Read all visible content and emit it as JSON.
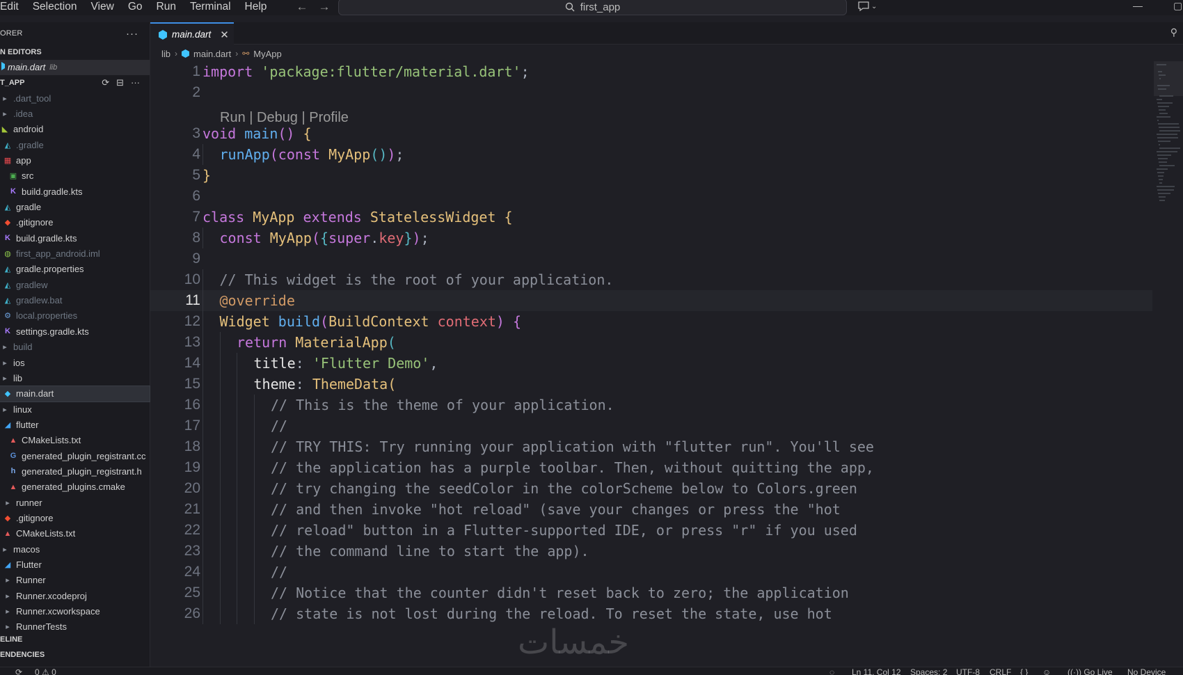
{
  "menu": [
    "Edit",
    "Selection",
    "View",
    "Go",
    "Run",
    "Terminal",
    "Help"
  ],
  "search": {
    "text": "first_app"
  },
  "sidebar": {
    "title": "ORER",
    "open_editors_title": "N EDITORS",
    "open_editor": {
      "name": "main.dart",
      "hint": "lib"
    },
    "project_title": "T_APP",
    "items": [
      {
        "label": ".dart_tool",
        "icon": "folder-icon",
        "dim": true,
        "indent": 0
      },
      {
        "label": ".idea",
        "icon": "folder-icon",
        "dim": true,
        "indent": 0
      },
      {
        "label": "android",
        "icon": "android-folder-icon",
        "dim": false,
        "indent": 0
      },
      {
        "label": ".gradle",
        "icon": "gradle-folder-icon",
        "dim": true,
        "indent": 1
      },
      {
        "label": "app",
        "icon": "app-folder-icon",
        "dim": false,
        "indent": 1
      },
      {
        "label": "src",
        "icon": "src-folder-icon",
        "dim": false,
        "indent": 2
      },
      {
        "label": "build.gradle.kts",
        "icon": "kotlin-icon",
        "dim": false,
        "indent": 2
      },
      {
        "label": "gradle",
        "icon": "gradle-folder-icon",
        "dim": false,
        "indent": 1
      },
      {
        "label": ".gitignore",
        "icon": "git-icon",
        "dim": false,
        "indent": 1
      },
      {
        "label": "build.gradle.kts",
        "icon": "kotlin-icon",
        "dim": false,
        "indent": 1
      },
      {
        "label": "first_app_android.iml",
        "icon": "iml-icon",
        "dim": true,
        "indent": 1
      },
      {
        "label": "gradle.properties",
        "icon": "gradle-icon",
        "dim": false,
        "indent": 1
      },
      {
        "label": "gradlew",
        "icon": "gradle-icon",
        "dim": true,
        "indent": 1
      },
      {
        "label": "gradlew.bat",
        "icon": "gradle-icon",
        "dim": true,
        "indent": 1
      },
      {
        "label": "local.properties",
        "icon": "gear-icon",
        "dim": true,
        "indent": 1
      },
      {
        "label": "settings.gradle.kts",
        "icon": "kotlin-icon",
        "dim": false,
        "indent": 1
      },
      {
        "label": "build",
        "icon": "folder-icon",
        "dim": true,
        "indent": 0
      },
      {
        "label": "ios",
        "icon": "folder-icon",
        "dim": false,
        "indent": 0
      },
      {
        "label": "lib",
        "icon": "folder-icon",
        "dim": false,
        "indent": 0
      },
      {
        "label": "main.dart",
        "icon": "dart-icon",
        "dim": false,
        "indent": 1,
        "selected": true
      },
      {
        "label": "linux",
        "icon": "folder-icon",
        "dim": false,
        "indent": 0
      },
      {
        "label": "flutter",
        "icon": "flutter-folder-icon",
        "dim": false,
        "indent": 1
      },
      {
        "label": "CMakeLists.txt",
        "icon": "cmake-icon",
        "dim": false,
        "indent": 2
      },
      {
        "label": "generated_plugin_registrant.cc",
        "icon": "cpp-icon",
        "dim": false,
        "indent": 2
      },
      {
        "label": "generated_plugin_registrant.h",
        "icon": "h-icon",
        "dim": false,
        "indent": 2
      },
      {
        "label": "generated_plugins.cmake",
        "icon": "cmake-icon",
        "dim": false,
        "indent": 2
      },
      {
        "label": "runner",
        "icon": "folder-icon",
        "dim": false,
        "indent": 1
      },
      {
        "label": ".gitignore",
        "icon": "git-icon",
        "dim": false,
        "indent": 1
      },
      {
        "label": "CMakeLists.txt",
        "icon": "cmake-icon",
        "dim": false,
        "indent": 1
      },
      {
        "label": "macos",
        "icon": "folder-icon",
        "dim": false,
        "indent": 0
      },
      {
        "label": "Flutter",
        "icon": "flutter-folder-icon",
        "dim": false,
        "indent": 1
      },
      {
        "label": "Runner",
        "icon": "folder-icon",
        "dim": false,
        "indent": 1
      },
      {
        "label": "Runner.xcodeproj",
        "icon": "folder-icon",
        "dim": false,
        "indent": 1
      },
      {
        "label": "Runner.xcworkspace",
        "icon": "folder-icon",
        "dim": false,
        "indent": 1
      },
      {
        "label": "RunnerTests",
        "icon": "folder-icon",
        "dim": false,
        "indent": 1
      }
    ],
    "timeline_title": "ELINE",
    "dependencies_title": "ENDENCIES"
  },
  "tab": {
    "label": "main.dart"
  },
  "breadcrumb": {
    "folder": "lib",
    "file": "main.dart",
    "symbol": "MyApp"
  },
  "codelens": "Run | Debug | Profile",
  "current_line": 11,
  "code_lines": [
    {
      "n": "1",
      "indent": 0,
      "tokens": [
        [
          "kw",
          "import"
        ],
        [
          "p",
          " "
        ],
        [
          "str",
          "'package:flutter/material.dart'"
        ],
        [
          "punc",
          ";"
        ]
      ]
    },
    {
      "n": "2",
      "indent": 0,
      "tokens": []
    },
    {
      "n": "3",
      "indent": 0,
      "tokens": [
        [
          "kw",
          "void"
        ],
        [
          "p",
          " "
        ],
        [
          "fn",
          "main"
        ],
        [
          "br2",
          "()"
        ],
        [
          "p",
          " "
        ],
        [
          "br",
          "{"
        ]
      ]
    },
    {
      "n": "4",
      "indent": 1,
      "tokens": [
        [
          "fn",
          "runApp"
        ],
        [
          "br2",
          "("
        ],
        [
          "kw",
          "const"
        ],
        [
          "p",
          " "
        ],
        [
          "cls",
          "MyApp"
        ],
        [
          "br3",
          "()"
        ],
        [
          "br2",
          ")"
        ],
        [
          "punc",
          ";"
        ]
      ]
    },
    {
      "n": "5",
      "indent": 0,
      "tokens": [
        [
          "br",
          "}"
        ]
      ]
    },
    {
      "n": "6",
      "indent": 0,
      "tokens": []
    },
    {
      "n": "7",
      "indent": 0,
      "tokens": [
        [
          "kw",
          "class"
        ],
        [
          "p",
          " "
        ],
        [
          "cls",
          "MyApp"
        ],
        [
          "p",
          " "
        ],
        [
          "kw",
          "extends"
        ],
        [
          "p",
          " "
        ],
        [
          "cls",
          "StatelessWidget"
        ],
        [
          "p",
          " "
        ],
        [
          "br",
          "{"
        ]
      ]
    },
    {
      "n": "8",
      "indent": 1,
      "tokens": [
        [
          "kw",
          "const"
        ],
        [
          "p",
          " "
        ],
        [
          "cls",
          "MyApp"
        ],
        [
          "br2",
          "("
        ],
        [
          "br3",
          "{"
        ],
        [
          "kw",
          "super"
        ],
        [
          "punc",
          "."
        ],
        [
          "var",
          "key"
        ],
        [
          "br3",
          "}"
        ],
        [
          "br2",
          ")"
        ],
        [
          "punc",
          ";"
        ]
      ]
    },
    {
      "n": "9",
      "indent": 0,
      "tokens": []
    },
    {
      "n": "10",
      "indent": 1,
      "tokens": [
        [
          "cmt",
          "// This widget is the root of your application."
        ]
      ]
    },
    {
      "n": "11",
      "indent": 1,
      "tokens": [
        [
          "ann",
          "@override"
        ]
      ]
    },
    {
      "n": "12",
      "indent": 1,
      "tokens": [
        [
          "cls",
          "Widget"
        ],
        [
          "p",
          " "
        ],
        [
          "fn",
          "build"
        ],
        [
          "br2",
          "("
        ],
        [
          "cls",
          "BuildContext"
        ],
        [
          "p",
          " "
        ],
        [
          "var",
          "context"
        ],
        [
          "br2",
          ")"
        ],
        [
          "p",
          " "
        ],
        [
          "br2",
          "{"
        ]
      ]
    },
    {
      "n": "13",
      "indent": 2,
      "tokens": [
        [
          "kw",
          "return"
        ],
        [
          "p",
          " "
        ],
        [
          "cls",
          "MaterialApp"
        ],
        [
          "br3",
          "("
        ]
      ]
    },
    {
      "n": "14",
      "indent": 3,
      "tokens": [
        [
          "prop",
          "title"
        ],
        [
          "punc",
          ":"
        ],
        [
          "p",
          " "
        ],
        [
          "str",
          "'Flutter Demo'"
        ],
        [
          "punc",
          ","
        ]
      ]
    },
    {
      "n": "15",
      "indent": 3,
      "tokens": [
        [
          "prop",
          "theme"
        ],
        [
          "punc",
          ":"
        ],
        [
          "p",
          " "
        ],
        [
          "cls",
          "ThemeData"
        ],
        [
          "br",
          "("
        ]
      ]
    },
    {
      "n": "16",
      "indent": 4,
      "tokens": [
        [
          "cmt",
          "// This is the theme of your application."
        ]
      ]
    },
    {
      "n": "17",
      "indent": 4,
      "tokens": [
        [
          "cmt",
          "//"
        ]
      ]
    },
    {
      "n": "18",
      "indent": 4,
      "tokens": [
        [
          "cmt",
          "// TRY THIS: Try running your application with \"flutter run\". You'll see"
        ]
      ]
    },
    {
      "n": "19",
      "indent": 4,
      "tokens": [
        [
          "cmt",
          "// the application has a purple toolbar. Then, without quitting the app,"
        ]
      ]
    },
    {
      "n": "20",
      "indent": 4,
      "tokens": [
        [
          "cmt",
          "// try changing the seedColor in the colorScheme below to Colors.green"
        ]
      ]
    },
    {
      "n": "21",
      "indent": 4,
      "tokens": [
        [
          "cmt",
          "// and then invoke \"hot reload\" (save your changes or press the \"hot"
        ]
      ]
    },
    {
      "n": "22",
      "indent": 4,
      "tokens": [
        [
          "cmt",
          "// reload\" button in a Flutter-supported IDE, or press \"r\" if you used"
        ]
      ]
    },
    {
      "n": "23",
      "indent": 4,
      "tokens": [
        [
          "cmt",
          "// the command line to start the app)."
        ]
      ]
    },
    {
      "n": "24",
      "indent": 4,
      "tokens": [
        [
          "cmt",
          "//"
        ]
      ]
    },
    {
      "n": "25",
      "indent": 4,
      "tokens": [
        [
          "cmt",
          "// Notice that the counter didn't reset back to zero; the application"
        ]
      ]
    },
    {
      "n": "26",
      "indent": 4,
      "tokens": [
        [
          "cmt",
          "// state is not lost during the reload. To reset the state, use hot"
        ]
      ]
    }
  ],
  "watermark": "خمسات",
  "statusbar": {
    "problems": "0 ⚠ 0",
    "position": "Ln 11, Col 12",
    "spaces": "Spaces: 2",
    "encoding": "UTF-8",
    "eol": "CRLF",
    "golive": "Go Live",
    "device": "No Device"
  },
  "colors": {
    "accent": "#3e8fe6",
    "keyword": "#c678dd",
    "string": "#98c379",
    "function": "#61afef",
    "class": "#e5c07b",
    "comment": "#8b8f99"
  }
}
